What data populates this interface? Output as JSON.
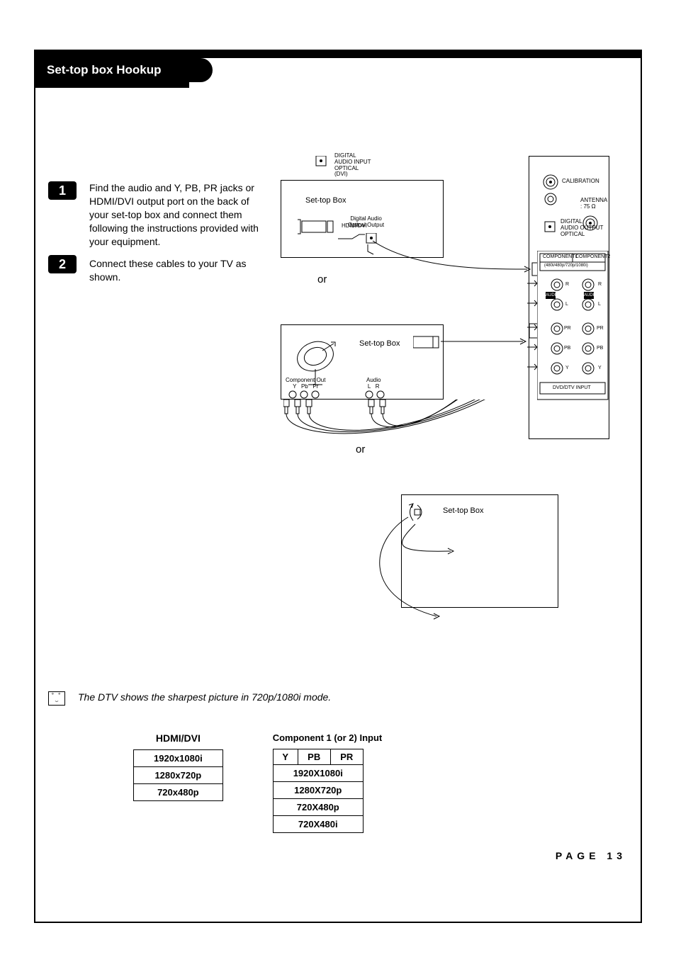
{
  "header": {
    "title": "Set-top box Hookup"
  },
  "steps": {
    "s1": {
      "num": "1",
      "text": "Find the audio and Y, PB, PR jacks or HDMI/DVI output port on the back of your set-top box and connect them following the instructions provided with your equipment."
    },
    "s2": {
      "num": "2",
      "text": "Connect these cables to your TV as shown."
    }
  },
  "tip": "The DTV shows the sharpest picture in 720p/1080i mode.",
  "hdmi_table": {
    "title": "HDMI/DVI",
    "rows": [
      "1920x1080i",
      "1280x720p",
      "720x480p"
    ]
  },
  "component_table": {
    "title": "Component 1 (or 2) Input",
    "headers": [
      "Y",
      "PB",
      "PR"
    ],
    "rows": [
      "1920X1080i",
      "1280X720p",
      "720X480p",
      "720X480i"
    ]
  },
  "page_number": "PAGE 13",
  "diagram": {
    "labels": {
      "stb": "Set-top Box",
      "digital_audio_out": "Digital Audio\nOptical Output",
      "or": "or",
      "component_out": "Component Out\nY   Pb   Pr",
      "audio_lr": "Audio\nL   R",
      "calibration": "CALIBRATION",
      "antenna": "ANTENNA\n: 75 Ω",
      "dig_audio_out_opt": "DIGITAL\nAUDIO OUTPUT\nOPTICAL",
      "dig_audio_in_opt": "DIGITAL\nAUDIO INPUT\nOPTICAL",
      "dig_audio_in_opt_dvi": "DIGITAL\nAUDIO INPUT\nOPTICAL\n(DVI)",
      "hdmi_dvi": "HDMI/DVI",
      "component1": "COMPONENT1",
      "component2": "COMPONENT2",
      "comp_res": "(480i/480p/720p/1080i)",
      "dvd_input": "DVD/DTV INPUT",
      "R": "R",
      "L": "L",
      "audio": "AUDIO",
      "Pr": "PR",
      "Pb": "PB",
      "Y": "Y"
    }
  }
}
